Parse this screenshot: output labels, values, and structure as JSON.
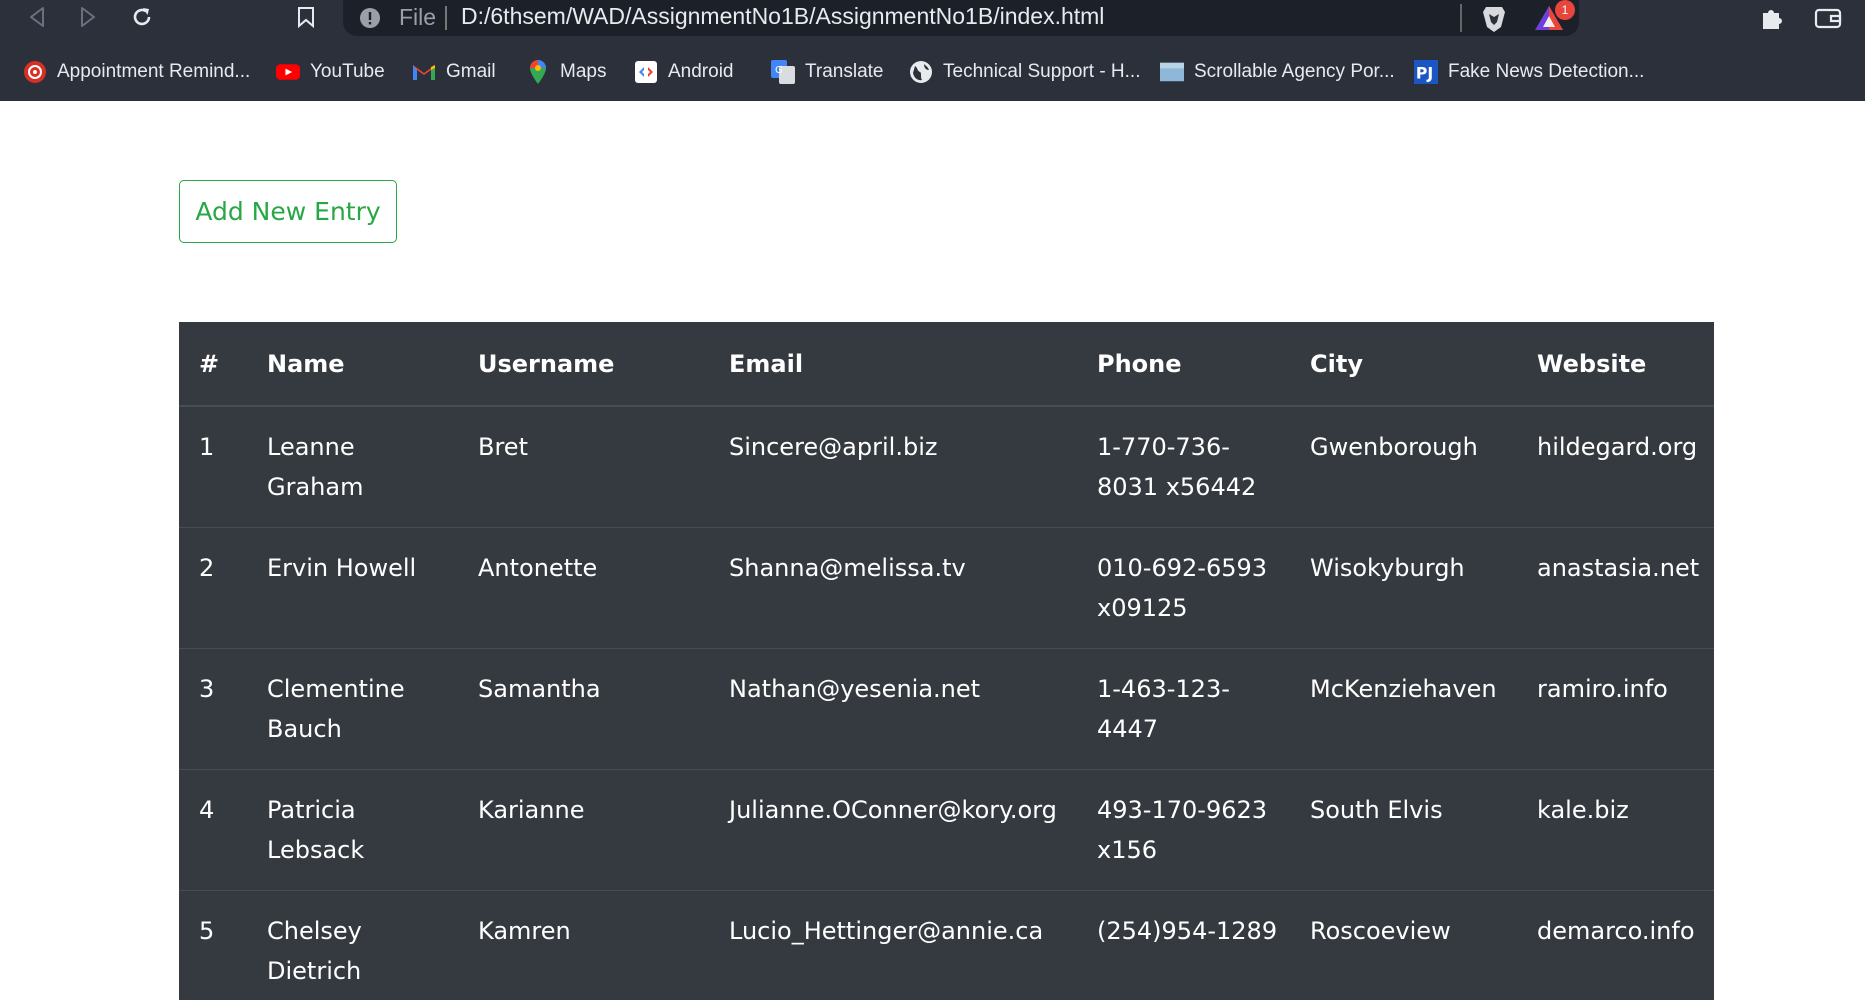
{
  "browser": {
    "file_label": "File",
    "url": "D:/6thsem/WAD/AssignmentNo1B/AssignmentNo1B/index.html",
    "rewards_badge": "1",
    "bookmarks": [
      {
        "label": "Appointment Remind...",
        "icon": "appointment-icon"
      },
      {
        "label": "YouTube",
        "icon": "youtube-icon"
      },
      {
        "label": "Gmail",
        "icon": "gmail-icon"
      },
      {
        "label": "Maps",
        "icon": "maps-icon"
      },
      {
        "label": "Android",
        "icon": "android-icon"
      },
      {
        "label": "Translate",
        "icon": "translate-icon"
      },
      {
        "label": "Technical Support - H...",
        "icon": "globe-icon"
      },
      {
        "label": "Scrollable Agency Por...",
        "icon": "page-thumbnail-icon"
      },
      {
        "label": "Fake News Detection...",
        "icon": "pj-icon"
      }
    ]
  },
  "page": {
    "add_button_label": "Add New Entry",
    "table": {
      "headers": [
        "#",
        "Name",
        "Username",
        "Email",
        "Phone",
        "City",
        "Website"
      ],
      "rows": [
        [
          "1",
          "Leanne Graham",
          "Bret",
          "Sincere@april.biz",
          "1-770-736-8031 x56442",
          "Gwenborough",
          "hildegard.org"
        ],
        [
          "2",
          "Ervin Howell",
          "Antonette",
          "Shanna@melissa.tv",
          "010-692-6593 x09125",
          "Wisokyburgh",
          "anastasia.net"
        ],
        [
          "3",
          "Clementine Bauch",
          "Samantha",
          "Nathan@yesenia.net",
          "1-463-123-4447",
          "McKenziehaven",
          "ramiro.info"
        ],
        [
          "4",
          "Patricia Lebsack",
          "Karianne",
          "Julianne.OConner@kory.org",
          "493-170-9623 x156",
          "South Elvis",
          "kale.biz"
        ],
        [
          "5",
          "Chelsey Dietrich",
          "Kamren",
          "Lucio_Hettinger@annie.ca",
          "(254)954-1289",
          "Roscoeview",
          "demarco.info"
        ]
      ]
    }
  },
  "colors": {
    "chrome_bg": "#2b303b",
    "success_green": "#28a745",
    "table_dark": "#343a40",
    "table_border": "#454d55"
  }
}
